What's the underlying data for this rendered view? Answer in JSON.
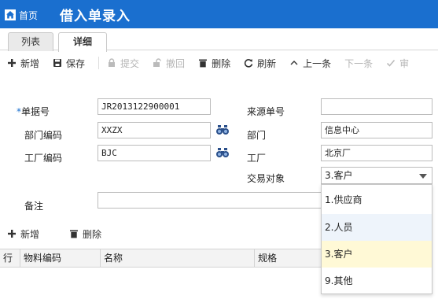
{
  "header": {
    "home_label": "首页",
    "title": "借入单录入"
  },
  "tabs": [
    {
      "label": "列表",
      "active": false
    },
    {
      "label": "详细",
      "active": true
    }
  ],
  "toolbar": {
    "add": "新增",
    "save": "保存",
    "submit": "提交",
    "revoke": "撤回",
    "delete": "删除",
    "refresh": "刷新",
    "prev": "上一条",
    "next": "下一条",
    "audit": "审"
  },
  "form": {
    "doc_no": {
      "label": "单据号",
      "required_mark": "*",
      "value": "JR2013122900001"
    },
    "source_no": {
      "label": "来源单号",
      "value": ""
    },
    "dept_code": {
      "label": "部门编码",
      "value": "XXZX"
    },
    "dept": {
      "label": "部门",
      "value": "信息中心"
    },
    "factory_code": {
      "label": "工厂编码",
      "value": "BJC"
    },
    "factory": {
      "label": "工厂",
      "value": "北京厂"
    },
    "counterparty": {
      "label": "交易对象",
      "value": "3.客户"
    },
    "remark": {
      "label": "备注",
      "value": ""
    }
  },
  "counterparty_options": [
    {
      "label": "1.供应商",
      "state": "normal"
    },
    {
      "label": "2.人员",
      "state": "hover"
    },
    {
      "label": "3.客户",
      "state": "selected"
    },
    {
      "label": "9.其他",
      "state": "normal"
    }
  ],
  "detail_toolbar": {
    "add": "新增",
    "delete": "删除"
  },
  "grid": {
    "columns": [
      "行",
      "物料编码",
      "名称",
      "规格"
    ]
  },
  "colors": {
    "brand": "#1a6fcf",
    "selected_option": "#fff9d6",
    "hover_option": "#eef4fb"
  }
}
